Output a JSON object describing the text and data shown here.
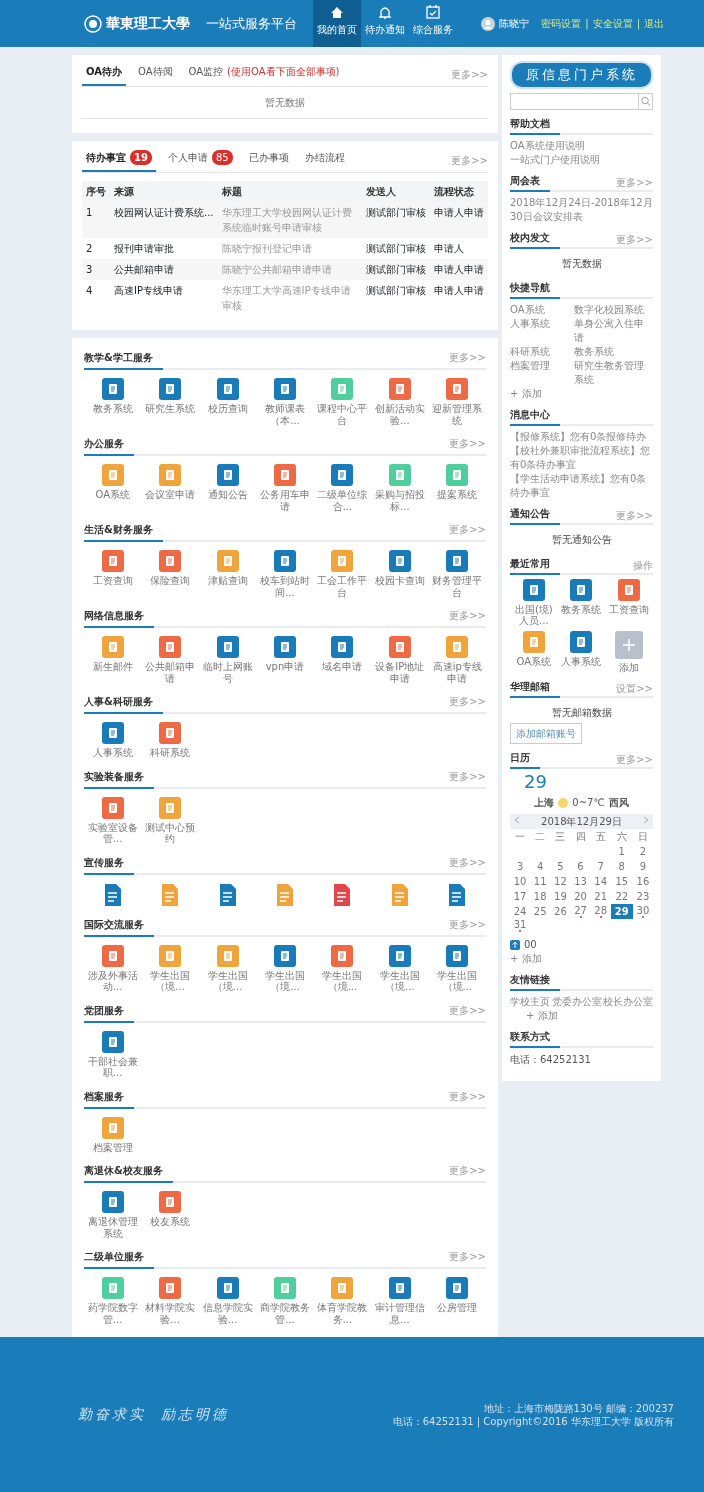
{
  "header": {
    "logo_text": "華東理工大學",
    "platform_title": "一站式服务平台",
    "nav": [
      {
        "label": "我的首页",
        "selected": true
      },
      {
        "label": "待办通知",
        "selected": false
      },
      {
        "label": "综合服务",
        "selected": false
      }
    ],
    "user": {
      "name": "陈晓宁",
      "links": [
        "密码设置",
        "安全设置",
        "退出"
      ],
      "separator": "|"
    }
  },
  "oa_panel": {
    "tabs": [
      {
        "label": "OA待办",
        "selected": true
      },
      {
        "label": "OA待阅",
        "selected": false
      },
      {
        "label": "OA监控",
        "note": "(使用OA看下面全部事项)",
        "selected": false
      }
    ],
    "more": "更多>>",
    "empty": "暂无数据"
  },
  "todo_panel": {
    "tabs": [
      {
        "label": "待办事宜",
        "badge": "19",
        "selected": true
      },
      {
        "label": "个人申请",
        "badge": "85",
        "selected": false
      },
      {
        "label": "已办事项",
        "selected": false
      },
      {
        "label": "办结流程",
        "selected": false
      }
    ],
    "more": "更多>>",
    "table": {
      "columns": [
        "序号",
        "来源",
        "标题",
        "发送人",
        "流程状态"
      ],
      "rows": [
        [
          "1",
          "校园网认证计费系统...",
          "华东理工大学校园网认证计费系统临时账号申请审核",
          "测试部门审核",
          "申请人申请"
        ],
        [
          "2",
          "报刊申请审批",
          "陈晓宁报刊登记申请",
          "测试部门审核",
          "申请人"
        ],
        [
          "3",
          "公共邮箱申请",
          "陈晓宁公共邮箱申请申请",
          "测试部门审核",
          "申请人申请"
        ],
        [
          "4",
          "高速IP专线申请",
          "华东理工大学高速IP专线申请审核",
          "测试部门审核",
          "申请人申请"
        ]
      ]
    }
  },
  "services": [
    {
      "title": "教学&学工服务",
      "more": "更多>>",
      "items": [
        {
          "kind": "tile",
          "label": "教务系统",
          "color": "#1a7bb9"
        },
        {
          "kind": "tile",
          "label": "研究生系统",
          "color": "#1a7bb9"
        },
        {
          "kind": "tile",
          "label": "校历查询",
          "color": "#1a7bb9"
        },
        {
          "kind": "tile",
          "label": "教师课表（本...",
          "color": "#1a7bb9"
        },
        {
          "kind": "tile",
          "label": "课程中心平台",
          "color": "#4fcf9e"
        },
        {
          "kind": "tile",
          "label": "创新活动实验...",
          "color": "#ee6a45"
        },
        {
          "kind": "tile",
          "label": "迎新管理系统",
          "color": "#ee6a45"
        }
      ]
    },
    {
      "title": "办公服务",
      "more": "更多>>",
      "items": [
        {
          "kind": "tile",
          "label": "OA系统",
          "color": "#f0a53c"
        },
        {
          "kind": "tile",
          "label": "会议室申请",
          "color": "#f0a53c"
        },
        {
          "kind": "tile",
          "label": "通知公告",
          "color": "#1a7bb9"
        },
        {
          "kind": "tile",
          "label": "公务用车申请",
          "color": "#ee6a45"
        },
        {
          "kind": "tile",
          "label": "二级单位综合...",
          "color": "#1a7bb9"
        },
        {
          "kind": "tile",
          "label": "采购与招投标...",
          "color": "#4fcf9e"
        },
        {
          "kind": "tile",
          "label": "提案系统",
          "color": "#4fcf9e"
        }
      ]
    },
    {
      "title": "生活&财务服务",
      "more": "更多>>",
      "items": [
        {
          "kind": "tile",
          "label": "工资查询",
          "color": "#ee6a45"
        },
        {
          "kind": "tile",
          "label": "保险查询",
          "color": "#ee6a45"
        },
        {
          "kind": "tile",
          "label": "津贴查询",
          "color": "#f0a53c"
        },
        {
          "kind": "tile",
          "label": "校车到站时间...",
          "color": "#1a7bb9"
        },
        {
          "kind": "tile",
          "label": "工会工作平台",
          "color": "#f0a53c"
        },
        {
          "kind": "tile",
          "label": "校园卡查询",
          "color": "#1a7bb9"
        },
        {
          "kind": "tile",
          "label": "财务管理平台",
          "color": "#1a7bb9"
        }
      ]
    },
    {
      "title": "网络信息服务",
      "more": "更多>>",
      "items": [
        {
          "kind": "tile",
          "label": "新生邮件",
          "color": "#f0a53c"
        },
        {
          "kind": "tile",
          "label": "公共邮箱申请",
          "color": "#ee6a45"
        },
        {
          "kind": "tile",
          "label": "临时上网账号",
          "color": "#1a7bb9"
        },
        {
          "kind": "tile",
          "label": "vpn申请",
          "color": "#1a7bb9"
        },
        {
          "kind": "tile",
          "label": "域名申请",
          "color": "#1a7bb9"
        },
        {
          "kind": "tile",
          "label": "设备IP地址申请",
          "color": "#ee6a45"
        },
        {
          "kind": "tile",
          "label": "高速ip专线申请",
          "color": "#f0a53c"
        }
      ]
    },
    {
      "title": "人事&科研服务",
      "more": "更多>>",
      "items": [
        {
          "kind": "tile",
          "label": "人事系统",
          "color": "#1a7bb9"
        },
        {
          "kind": "tile",
          "label": "科研系统",
          "color": "#ee6a45"
        }
      ]
    },
    {
      "title": "实验装备服务",
      "more": "更多>>",
      "items": [
        {
          "kind": "tile",
          "label": "实验室设备管...",
          "color": "#ee6a45"
        },
        {
          "kind": "tile",
          "label": "测试中心预约",
          "color": "#f0a53c"
        }
      ]
    },
    {
      "title": "宣传服务",
      "more": "更多>>",
      "items": [
        {
          "kind": "glyph",
          "color": "#1a7bb9"
        },
        {
          "kind": "glyph",
          "color": "#f0a53c"
        },
        {
          "kind": "glyph",
          "color": "#1a7bb9"
        },
        {
          "kind": "glyph",
          "color": "#f0a53c"
        },
        {
          "kind": "glyph",
          "color": "#e0474c"
        },
        {
          "kind": "glyph",
          "color": "#f0a53c"
        },
        {
          "kind": "glyph",
          "color": "#1a7bb9"
        }
      ]
    },
    {
      "title": "国际交流服务",
      "more": "更多>>",
      "items": [
        {
          "kind": "tile",
          "label": "涉及外事活动...",
          "color": "#ee6a45"
        },
        {
          "kind": "tile",
          "label": "学生出国（境...",
          "color": "#f0a53c"
        },
        {
          "kind": "tile",
          "label": "学生出国（境...",
          "color": "#f0a53c"
        },
        {
          "kind": "tile",
          "label": "学生出国（境...",
          "color": "#1a7bb9"
        },
        {
          "kind": "tile",
          "label": "学生出国（境...",
          "color": "#ee6a45"
        },
        {
          "kind": "tile",
          "label": "学生出国（境...",
          "color": "#1a7bb9"
        },
        {
          "kind": "tile",
          "label": "学生出国（境...",
          "color": "#1a7bb9"
        }
      ]
    },
    {
      "title": "党团服务",
      "more": "更多>>",
      "items": [
        {
          "kind": "tile",
          "label": "干部社会兼职...",
          "color": "#1a7bb9"
        }
      ]
    },
    {
      "title": "档案服务",
      "more": "更多>>",
      "items": [
        {
          "kind": "tile",
          "label": "档案管理",
          "color": "#f0a53c"
        }
      ]
    },
    {
      "title": "离退休&校友服务",
      "more": "更多>>",
      "items": [
        {
          "kind": "tile",
          "label": "离退休管理系统",
          "color": "#1a7bb9"
        },
        {
          "kind": "tile",
          "label": "校友系统",
          "color": "#ee6a45"
        }
      ]
    },
    {
      "title": "二级单位服务",
      "more": "更多>>",
      "items": [
        {
          "kind": "tile",
          "label": "药学院数字管...",
          "color": "#4fcf9e"
        },
        {
          "kind": "tile",
          "label": "材料学院实验...",
          "color": "#ee6a45"
        },
        {
          "kind": "tile",
          "label": "信息学院实验...",
          "color": "#1a7bb9"
        },
        {
          "kind": "tile",
          "label": "商学院教务管...",
          "color": "#4fcf9e"
        },
        {
          "kind": "tile",
          "label": "体育学院教务...",
          "color": "#f0a53c"
        },
        {
          "kind": "tile",
          "label": "审计管理信息...",
          "color": "#1a7bb9"
        },
        {
          "kind": "tile",
          "label": "公房管理",
          "color": "#1a7bb9"
        }
      ]
    }
  ],
  "sidebar": {
    "banner": "原信息门户系统",
    "help_docs": {
      "title": "帮助文档",
      "links": [
        "OA系统使用说明",
        "一站式门户使用说明"
      ]
    },
    "meetings": {
      "title": "周会表",
      "more": "更多>>",
      "text": "2018年12月24日-2018年12月30日会议安排表"
    },
    "documents": {
      "title": "校内发文",
      "more": "更多>>",
      "empty": "暂无数据"
    },
    "quick_nav": {
      "title": "快捷导航",
      "links": [
        "OA系统",
        "数字化校园系统",
        "人事系统",
        "单身公寓入住申请",
        "科研系统",
        "教务系统",
        "档案管理",
        "研究生教务管理系统"
      ],
      "add": "+ 添加"
    },
    "messages": {
      "title": "消息中心",
      "items": [
        "【报修系统】您有0条报修待办",
        "【校社外兼职审批流程系统】您有0条待办事宜",
        "【学生活动申请系统】您有0条待办事宜"
      ]
    },
    "notices": {
      "title": "通知公告",
      "more": "更多>>",
      "empty": "暂无通知公告"
    },
    "recent": {
      "title": "最近常用",
      "action": "操作",
      "apps": [
        {
          "kind": "tile",
          "label": "出国(境)人员...",
          "color": "#1a7bb9"
        },
        {
          "kind": "tile",
          "label": "教务系统",
          "color": "#1a7bb9"
        },
        {
          "kind": "tile",
          "label": "工资查询",
          "color": "#ee6a45"
        },
        {
          "kind": "tile",
          "label": "OA系统",
          "color": "#f0a53c"
        },
        {
          "kind": "tile",
          "label": "人事系统",
          "color": "#1a7bb9"
        },
        {
          "kind": "add",
          "label": "添加",
          "color": "#b9c0cc"
        }
      ]
    },
    "mail": {
      "title": "华理邮箱",
      "more": "设置>>",
      "empty": "暂无邮箱数据",
      "button": "添加邮箱账号"
    },
    "calendar": {
      "title": "日历",
      "more": "更多>>",
      "big_day": "29",
      "city": "上海",
      "temperature": "0~7℃",
      "wind": "西风",
      "month_label": "2018年12月29日",
      "weekdays": [
        "一",
        "二",
        "三",
        "四",
        "五",
        "六",
        "日"
      ],
      "weeks": [
        [
          {
            "day": "1",
            "selected": false,
            "event": false
          },
          {
            "day": "2",
            "selected": false,
            "event": false
          }
        ],
        [
          {
            "day": "3",
            "selected": false,
            "event": false
          },
          {
            "day": "4",
            "selected": false,
            "event": false
          },
          {
            "day": "5",
            "selected": false,
            "event": false
          },
          {
            "day": "6",
            "selected": false,
            "event": false
          },
          {
            "day": "7",
            "selected": false,
            "event": false
          },
          {
            "day": "8",
            "selected": false,
            "event": false
          },
          {
            "day": "9",
            "selected": false,
            "event": false
          }
        ],
        [
          {
            "day": "10",
            "selected": false,
            "event": false
          },
          {
            "day": "11",
            "selected": false,
            "event": false
          },
          {
            "day": "12",
            "selected": false,
            "event": false
          },
          {
            "day": "13",
            "selected": false,
            "event": false
          },
          {
            "day": "14",
            "selected": false,
            "event": false
          },
          {
            "day": "15",
            "selected": false,
            "event": false
          },
          {
            "day": "16",
            "selected": false,
            "event": false
          }
        ],
        [
          {
            "day": "17",
            "selected": false,
            "event": false
          },
          {
            "day": "18",
            "selected": false,
            "event": false
          },
          {
            "day": "19",
            "selected": false,
            "event": false
          },
          {
            "day": "20",
            "selected": false,
            "event": false
          },
          {
            "day": "21",
            "selected": false,
            "event": false
          },
          {
            "day": "22",
            "selected": false,
            "event": false
          },
          {
            "day": "23",
            "selected": false,
            "event": false
          }
        ],
        [
          {
            "day": "24",
            "selected": false,
            "event": false
          },
          {
            "day": "25",
            "selected": false,
            "event": false
          },
          {
            "day": "26",
            "selected": false,
            "event": false
          },
          {
            "day": "27",
            "selected": false,
            "event": true
          },
          {
            "day": "28",
            "selected": false,
            "event": true
          },
          {
            "day": "29",
            "selected": true,
            "event": false
          },
          {
            "day": "30",
            "selected": false,
            "event": true
          }
        ],
        [
          {
            "day": "31",
            "selected": false,
            "event": true
          }
        ]
      ],
      "counter": "00",
      "add": "+ 添加"
    },
    "friend_links": {
      "title": "友情链接",
      "links": [
        "学校主页",
        "党委办公室",
        "校长办公室"
      ],
      "add": "+ 添加"
    },
    "contact": {
      "title": "联系方式",
      "text": "电话：64252131"
    }
  },
  "footer": {
    "motto": "勤奋求实  励志明德",
    "address": "地址：上海市梅陇路130号  邮编：200237",
    "copyright": "电话：64252131 | Copyright©2016 华东理工大学 版权所有"
  }
}
